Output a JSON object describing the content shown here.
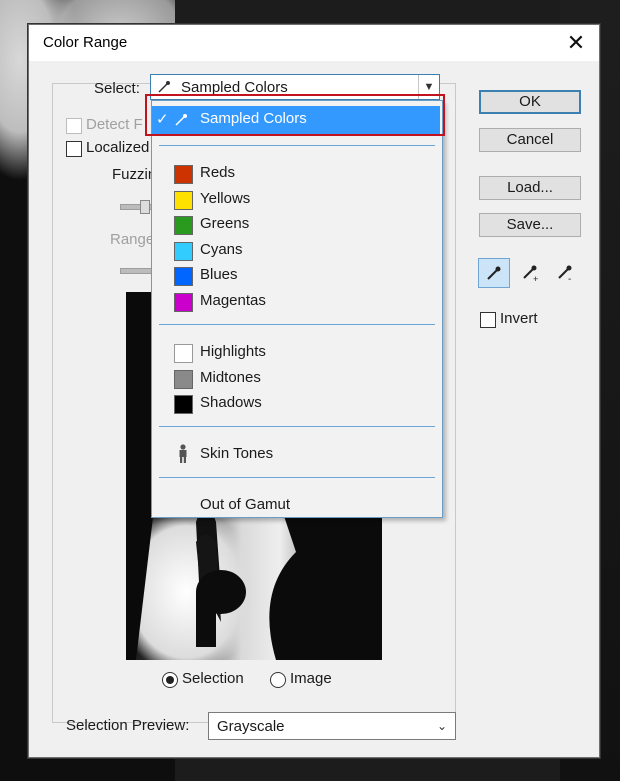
{
  "dialog": {
    "title": "Color Range",
    "close_glyph": "✕",
    "select_label": "Select:",
    "select_value": "Sampled Colors",
    "detect_faces_label": "Detect F",
    "localized_label": "Localized",
    "fuzziness_label": "Fuzzin",
    "range_label": "Range",
    "selection_radio": "Selection",
    "image_radio": "Image",
    "selection_preview_label": "Selection Preview:",
    "selection_preview_value": "Grayscale",
    "invert_label": "Invert"
  },
  "buttons": {
    "ok": "OK",
    "cancel": "Cancel",
    "load": "Load...",
    "save": "Save..."
  },
  "dropdown": {
    "selected": {
      "check": "✓",
      "label": "Sampled Colors"
    },
    "colors": [
      {
        "label": "Reds",
        "color": "#cc3300"
      },
      {
        "label": "Yellows",
        "color": "#ffe100"
      },
      {
        "label": "Greens",
        "color": "#2a9a1e"
      },
      {
        "label": "Cyans",
        "color": "#33ccff"
      },
      {
        "label": "Blues",
        "color": "#0066ff"
      },
      {
        "label": "Magentas",
        "color": "#cc00cc"
      }
    ],
    "tones": [
      {
        "label": "Highlights",
        "color": "#ffffff"
      },
      {
        "label": "Midtones",
        "color": "#8a8a8a"
      },
      {
        "label": "Shadows",
        "color": "#000000"
      }
    ],
    "skin": "Skin Tones",
    "gamut": "Out of Gamut"
  },
  "colors": {
    "accent": "#3399ff",
    "highlight_border": "#c1121f"
  }
}
